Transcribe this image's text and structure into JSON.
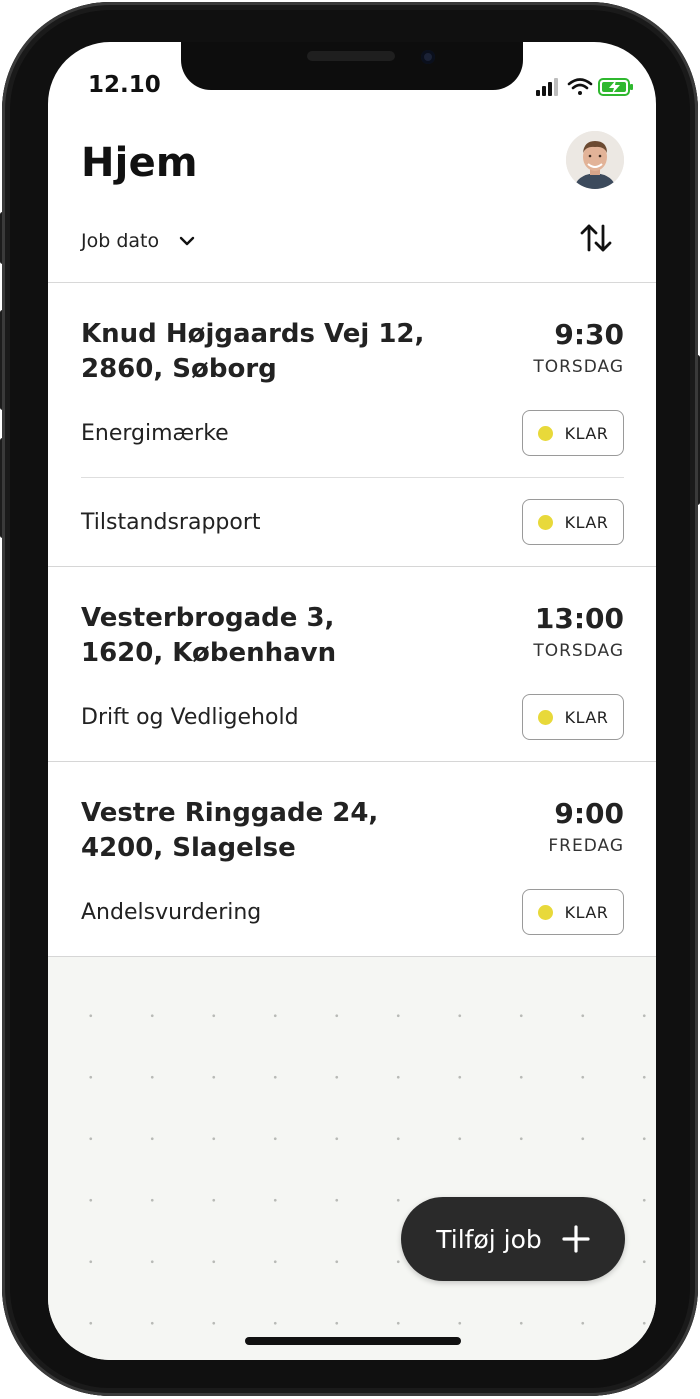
{
  "status_bar": {
    "time": "12.10"
  },
  "header": {
    "title": "Hjem"
  },
  "sort": {
    "label": "Job dato"
  },
  "jobs": [
    {
      "address_line1": "Knud Højgaards Vej 12,",
      "address_line2": "2860, Søborg",
      "time": "9:30",
      "day": "TORSDAG",
      "tasks": [
        {
          "title": "Energimærke",
          "status": "KLAR"
        },
        {
          "title": "Tilstandsrapport",
          "status": "KLAR"
        }
      ]
    },
    {
      "address_line1": "Vesterbrogade 3,",
      "address_line2": "1620, København",
      "time": "13:00",
      "day": "TORSDAG",
      "tasks": [
        {
          "title": "Drift og Vedligehold",
          "status": "KLAR"
        }
      ]
    },
    {
      "address_line1": "Vestre Ringgade 24,",
      "address_line2": "4200, Slagelse",
      "time": "9:00",
      "day": "FREDAG",
      "tasks": [
        {
          "title": "Andelsvurdering",
          "status": "KLAR"
        }
      ]
    }
  ],
  "fab": {
    "label": "Tilføj job"
  },
  "colors": {
    "status_dot": "#e8d93a",
    "fab_background": "#2a2a2a",
    "background_area": "#f5f6f3"
  },
  "icons": {
    "signal": "cellular-signal-icon",
    "wifi": "wifi-icon",
    "battery": "battery-charging-icon",
    "chevron": "chevron-down-icon",
    "sort": "sort-arrows-icon",
    "plus": "plus-icon",
    "avatar": "user-avatar"
  }
}
